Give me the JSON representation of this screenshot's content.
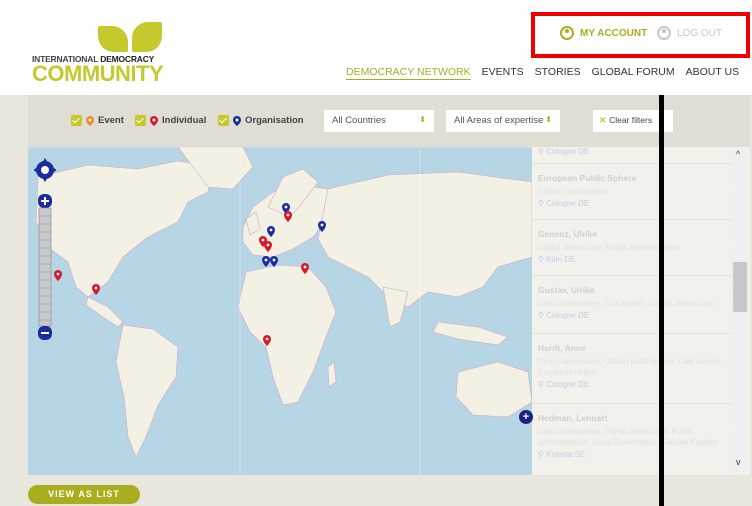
{
  "logo": {
    "line1_a": "INTERNATIONAL ",
    "line1_b": "DEMOCRACY",
    "line2": "COMMUNITY"
  },
  "account": {
    "my_account": "MY ACCOUNT",
    "log_out": "LOG OUT"
  },
  "nav": {
    "items": [
      "DEMOCRACY NETWORK",
      "EVENTS",
      "STORIES",
      "GLOBAL FORUM",
      "ABOUT US"
    ],
    "active_index": 0
  },
  "filters": {
    "event_label": "Event",
    "individual_label": "Individual",
    "organisation_label": "Organisation",
    "countries_select": "All Countries",
    "areas_select": "All Areas of expertise",
    "clear_label": "Clear filters"
  },
  "list": [
    {
      "name": "",
      "tags": "",
      "location": "Cologne DE"
    },
    {
      "name": "European Public Sphere",
      "tags": "Citizen participation",
      "location": "Cologne DE"
    },
    {
      "name": "Genenz, Ulrike",
      "tags": "Digital democracy, Public administration",
      "location": "Köln DE"
    },
    {
      "name": "Gustav, Ulrike",
      "tags": "Direct democracy, Civil society, Digital democracy",
      "location": "Cologne DE"
    },
    {
      "name": "Hardt, Anne",
      "tags": "Direct democracy, Citizen participation, Civil society, European Union",
      "location": "Cologne DE"
    },
    {
      "name": "Hedman, Lennart",
      "tags": "Direct democracy, Digital democracy, Public administration, Local Governance, Gender Equality",
      "location": "Knivsta SE"
    }
  ],
  "view_as_list": "VIEW AS LIST",
  "colors": {
    "accent": "#a8ae1e",
    "brand_green": "#c5c92c",
    "event_pin": "#f08a24",
    "individual_pin": "#d6182b",
    "organisation_pin": "#1a2ca0",
    "highlight_box": "#ee0000"
  }
}
